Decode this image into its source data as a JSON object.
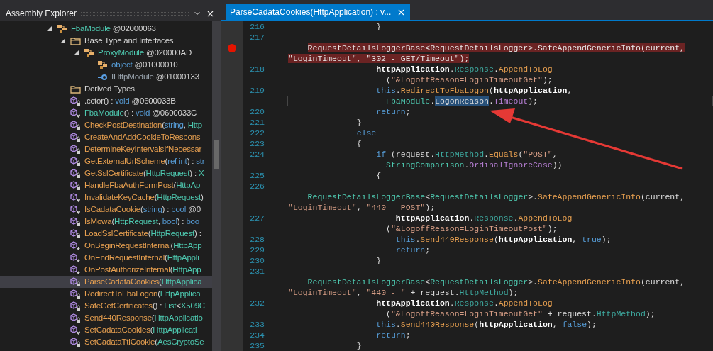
{
  "explorer": {
    "title": "Assembly Explorer",
    "tree": [
      {
        "kind": "class",
        "expanded": true,
        "selected": false,
        "parts": [
          {
            "text": "FbaModule",
            "kind": "type"
          },
          {
            "text": " @02000063",
            "kind": "plain"
          }
        ],
        "children": [
          {
            "kind": "folder",
            "expanded": true,
            "selected": false,
            "parts": [
              {
                "text": "Base Type and Interfaces",
                "kind": "plain"
              }
            ],
            "children": [
              {
                "kind": "class",
                "expanded": true,
                "selected": false,
                "parts": [
                  {
                    "text": "ProxyModule",
                    "kind": "type"
                  },
                  {
                    "text": " @020000AD",
                    "kind": "plain"
                  }
                ],
                "children": [
                  {
                    "kind": "class",
                    "selected": false,
                    "parts": [
                      {
                        "text": "object",
                        "kind": "keyword"
                      },
                      {
                        "text": " @01000010",
                        "kind": "plain"
                      }
                    ]
                  },
                  {
                    "kind": "interface",
                    "selected": false,
                    "parts": [
                      {
                        "text": "IHttpModule",
                        "kind": "interface"
                      },
                      {
                        "text": " @01000133",
                        "kind": "plain"
                      }
                    ]
                  }
                ]
              }
            ]
          },
          {
            "kind": "folder",
            "selected": false,
            "parts": [
              {
                "text": "Derived Types",
                "kind": "plain"
              }
            ]
          },
          {
            "kind": "method-private",
            "selected": false,
            "parts": [
              {
                "text": ".cctor() : ",
                "kind": "plain"
              },
              {
                "text": "void",
                "kind": "keyword"
              },
              {
                "text": " @0600033B",
                "kind": "plain"
              }
            ]
          },
          {
            "kind": "method-internal",
            "selected": false,
            "parts": [
              {
                "text": "FbaModule",
                "kind": "type"
              },
              {
                "text": "() : ",
                "kind": "plain"
              },
              {
                "text": "void",
                "kind": "keyword"
              },
              {
                "text": " @0600033C",
                "kind": "plain"
              }
            ]
          },
          {
            "kind": "method-private",
            "selected": false,
            "parts": [
              {
                "text": "CheckPostDestination",
                "kind": "method"
              },
              {
                "text": "(",
                "kind": "plain"
              },
              {
                "text": "string",
                "kind": "keyword"
              },
              {
                "text": ", ",
                "kind": "plain"
              },
              {
                "text": "Http",
                "kind": "type"
              }
            ]
          },
          {
            "kind": "method-private",
            "selected": false,
            "parts": [
              {
                "text": "CreateAndAddCookieToRespons",
                "kind": "method"
              }
            ]
          },
          {
            "kind": "method-private",
            "selected": false,
            "parts": [
              {
                "text": "DetermineKeyIntervalsIfNecessar",
                "kind": "method"
              }
            ]
          },
          {
            "kind": "method-private",
            "selected": false,
            "parts": [
              {
                "text": "GetExternalUrlScheme",
                "kind": "method"
              },
              {
                "text": "(",
                "kind": "plain"
              },
              {
                "text": "ref int",
                "kind": "keyword"
              },
              {
                "text": ") : ",
                "kind": "plain"
              },
              {
                "text": "str",
                "kind": "keyword"
              }
            ]
          },
          {
            "kind": "method-private",
            "selected": false,
            "parts": [
              {
                "text": "GetSslCertificate",
                "kind": "method"
              },
              {
                "text": "(",
                "kind": "plain"
              },
              {
                "text": "HttpRequest",
                "kind": "type"
              },
              {
                "text": ") : ",
                "kind": "plain"
              },
              {
                "text": "X",
                "kind": "type"
              }
            ]
          },
          {
            "kind": "method-private",
            "selected": false,
            "parts": [
              {
                "text": "HandleFbaAuthFormPost",
                "kind": "method"
              },
              {
                "text": "(",
                "kind": "plain"
              },
              {
                "text": "HttpAp",
                "kind": "type"
              }
            ]
          },
          {
            "kind": "method-internal",
            "selected": false,
            "parts": [
              {
                "text": "InvalidateKeyCache",
                "kind": "method"
              },
              {
                "text": "(",
                "kind": "plain"
              },
              {
                "text": "HttpRequest",
                "kind": "type"
              },
              {
                "text": ")",
                "kind": "plain"
              }
            ]
          },
          {
            "kind": "method-internal",
            "selected": false,
            "parts": [
              {
                "text": "IsCadataCookie",
                "kind": "method"
              },
              {
                "text": "(",
                "kind": "plain"
              },
              {
                "text": "string",
                "kind": "keyword"
              },
              {
                "text": ") : ",
                "kind": "plain"
              },
              {
                "text": "bool",
                "kind": "keyword"
              },
              {
                "text": " @0",
                "kind": "plain"
              }
            ]
          },
          {
            "kind": "method-private",
            "selected": false,
            "parts": [
              {
                "text": "IsMowa",
                "kind": "method"
              },
              {
                "text": "(",
                "kind": "plain"
              },
              {
                "text": "HttpRequest",
                "kind": "type"
              },
              {
                "text": ", ",
                "kind": "plain"
              },
              {
                "text": "bool",
                "kind": "keyword"
              },
              {
                "text": ") : ",
                "kind": "plain"
              },
              {
                "text": "boo",
                "kind": "keyword"
              }
            ]
          },
          {
            "kind": "method-private",
            "selected": false,
            "parts": [
              {
                "text": "LoadSslCertificate",
                "kind": "method"
              },
              {
                "text": "(",
                "kind": "plain"
              },
              {
                "text": "HttpRequest",
                "kind": "type"
              },
              {
                "text": ") :",
                "kind": "plain"
              }
            ]
          },
          {
            "kind": "method-static",
            "selected": false,
            "parts": [
              {
                "text": "OnBeginRequestInternal",
                "kind": "method"
              },
              {
                "text": "(",
                "kind": "plain"
              },
              {
                "text": "HttpApp",
                "kind": "type"
              }
            ]
          },
          {
            "kind": "method-static",
            "selected": false,
            "parts": [
              {
                "text": "OnEndRequestInternal",
                "kind": "method"
              },
              {
                "text": "(",
                "kind": "plain"
              },
              {
                "text": "HttpAppli",
                "kind": "type"
              }
            ]
          },
          {
            "kind": "method-static",
            "selected": false,
            "parts": [
              {
                "text": "OnPostAuthorizeInternal",
                "kind": "method"
              },
              {
                "text": "(",
                "kind": "plain"
              },
              {
                "text": "HttpApp",
                "kind": "type"
              }
            ]
          },
          {
            "kind": "method-private",
            "selected": true,
            "parts": [
              {
                "text": "ParseCadataCookies",
                "kind": "method"
              },
              {
                "text": "(",
                "kind": "plain"
              },
              {
                "text": "HttpApplica",
                "kind": "type"
              }
            ]
          },
          {
            "kind": "method-private",
            "selected": false,
            "parts": [
              {
                "text": "RedirectToFbaLogon",
                "kind": "method"
              },
              {
                "text": "(",
                "kind": "plain"
              },
              {
                "text": "HttpApplica",
                "kind": "type"
              }
            ]
          },
          {
            "kind": "method-private",
            "selected": false,
            "parts": [
              {
                "text": "SafeGetCertificates",
                "kind": "method"
              },
              {
                "text": "() : ",
                "kind": "plain"
              },
              {
                "text": "List",
                "kind": "type"
              },
              {
                "text": "<",
                "kind": "plain"
              },
              {
                "text": "X509C",
                "kind": "type"
              }
            ]
          },
          {
            "kind": "method-private",
            "selected": false,
            "parts": [
              {
                "text": "Send440Response",
                "kind": "method"
              },
              {
                "text": "(",
                "kind": "plain"
              },
              {
                "text": "HttpApplicatio",
                "kind": "type"
              }
            ]
          },
          {
            "kind": "method-internal",
            "selected": false,
            "parts": [
              {
                "text": "SetCadataCookies",
                "kind": "method"
              },
              {
                "text": "(",
                "kind": "plain"
              },
              {
                "text": "HttpApplicati",
                "kind": "type"
              }
            ]
          },
          {
            "kind": "method-private",
            "selected": false,
            "parts": [
              {
                "text": "SetCadataTtlCookie",
                "kind": "method"
              },
              {
                "text": "(",
                "kind": "plain"
              },
              {
                "text": "AesCryptoSe",
                "kind": "type"
              }
            ]
          }
        ]
      }
    ]
  },
  "editor": {
    "tabs": [
      {
        "label": "ParseCadataCookies(HttpApplication) : v...",
        "selected": true
      }
    ],
    "rows": [
      {
        "number": "216",
        "breakpoint": false,
        "error": false,
        "current": false,
        "tokens": [
          {
            "text": "                  }",
            "kind": "plain"
          }
        ]
      },
      {
        "number": "217",
        "breakpoint": false
      },
      {
        "breakpoint": true,
        "error": true,
        "current": false,
        "tokens": [
          {
            "text": "    RequestDetailsLoggerBase<RequestDetailsLogger>.SafeAppendGenericInfo(current,",
            "kind": "plain"
          }
        ]
      },
      {
        "breakpoint": false,
        "error": true,
        "current": false,
        "tokens": [
          {
            "text": "\"LoginTimeout\", \"302 - GET/Timeout\");",
            "kind": "plain"
          }
        ]
      },
      {
        "number": "218",
        "breakpoint": false,
        "error": false,
        "current": false,
        "tokens": [
          {
            "text": "                  httpApplication",
            "kind": "bold"
          },
          {
            "text": ".",
            "kind": "plain"
          },
          {
            "text": "Response",
            "kind": "member"
          },
          {
            "text": ".",
            "kind": "plain"
          },
          {
            "text": "AppendToLog",
            "kind": "method"
          }
        ]
      },
      {
        "breakpoint": false,
        "error": false,
        "current": false,
        "tokens": [
          {
            "text": "                    (",
            "kind": "plain"
          },
          {
            "text": "\"&LogoffReason=LoginTimeoutGet\"",
            "kind": "string"
          },
          {
            "text": ");",
            "kind": "plain"
          }
        ]
      },
      {
        "number": "219",
        "breakpoint": false,
        "error": false,
        "current": false,
        "tokens": [
          {
            "text": "                  this",
            "kind": "keyword"
          },
          {
            "text": ".",
            "kind": "plain"
          },
          {
            "text": "RedirectToFbaLogon",
            "kind": "method"
          },
          {
            "text": "(",
            "kind": "plain"
          },
          {
            "text": "httpApplication",
            "kind": "bold"
          },
          {
            "text": ",",
            "kind": "plain"
          }
        ]
      },
      {
        "breakpoint": false,
        "error": false,
        "current": true,
        "tokens": [
          {
            "text": "                    FbaModule",
            "kind": "type"
          },
          {
            "text": ".",
            "kind": "plain"
          },
          {
            "text": "LogonReason",
            "kind": "selection"
          },
          {
            "text": ".",
            "kind": "plain"
          },
          {
            "text": "Timeout",
            "kind": "enum"
          },
          {
            "text": ");",
            "kind": "plain"
          }
        ]
      },
      {
        "number": "220",
        "breakpoint": false,
        "error": false,
        "current": false,
        "tokens": [
          {
            "text": "                  return",
            "kind": "keyword"
          },
          {
            "text": ";",
            "kind": "plain"
          }
        ]
      },
      {
        "number": "221",
        "breakpoint": false,
        "error": false,
        "current": false,
        "tokens": [
          {
            "text": "              }",
            "kind": "plain"
          }
        ]
      },
      {
        "number": "222",
        "breakpoint": false,
        "error": false,
        "current": false,
        "tokens": [
          {
            "text": "              else",
            "kind": "keyword"
          }
        ]
      },
      {
        "number": "223",
        "breakpoint": false,
        "error": false,
        "current": false,
        "tokens": [
          {
            "text": "              {",
            "kind": "plain"
          }
        ]
      },
      {
        "number": "224",
        "breakpoint": false,
        "error": false,
        "current": false,
        "tokens": [
          {
            "text": "                  if",
            "kind": "keyword"
          },
          {
            "text": " (request.",
            "kind": "plain"
          },
          {
            "text": "HttpMethod",
            "kind": "member"
          },
          {
            "text": ".",
            "kind": "plain"
          },
          {
            "text": "Equals",
            "kind": "method"
          },
          {
            "text": "(",
            "kind": "plain"
          },
          {
            "text": "\"POST\"",
            "kind": "string"
          },
          {
            "text": ",",
            "kind": "plain"
          }
        ]
      },
      {
        "breakpoint": false,
        "error": false,
        "current": false,
        "tokens": [
          {
            "text": "                    StringComparison",
            "kind": "type"
          },
          {
            "text": ".",
            "kind": "plain"
          },
          {
            "text": "OrdinalIgnoreCase",
            "kind": "enum"
          },
          {
            "text": "))",
            "kind": "plain"
          }
        ]
      },
      {
        "number": "225",
        "breakpoint": false,
        "error": false,
        "current": false,
        "tokens": [
          {
            "text": "                  {",
            "kind": "plain"
          }
        ]
      },
      {
        "number": "226",
        "breakpoint": false
      },
      {
        "breakpoint": false,
        "error": false,
        "current": false,
        "tokens": [
          {
            "text": "    RequestDetailsLoggerBase",
            "kind": "type"
          },
          {
            "text": "<",
            "kind": "plain"
          },
          {
            "text": "RequestDetailsLogger",
            "kind": "type"
          },
          {
            "text": ">.",
            "kind": "plain"
          },
          {
            "text": "SafeAppendGenericInfo",
            "kind": "method"
          },
          {
            "text": "(current,",
            "kind": "plain"
          }
        ]
      },
      {
        "breakpoint": false,
        "error": false,
        "current": false,
        "tokens": [
          {
            "text": "\"LoginTimeout\"",
            "kind": "string"
          },
          {
            "text": ", ",
            "kind": "plain"
          },
          {
            "text": "\"440 - POST\"",
            "kind": "string"
          },
          {
            "text": ");",
            "kind": "plain"
          }
        ]
      },
      {
        "number": "227",
        "breakpoint": false,
        "error": false,
        "current": false,
        "tokens": [
          {
            "text": "                      httpApplication",
            "kind": "bold"
          },
          {
            "text": ".",
            "kind": "plain"
          },
          {
            "text": "Response",
            "kind": "member"
          },
          {
            "text": ".",
            "kind": "plain"
          },
          {
            "text": "AppendToLog",
            "kind": "method"
          }
        ]
      },
      {
        "breakpoint": false,
        "error": false,
        "current": false,
        "tokens": [
          {
            "text": "                    (",
            "kind": "plain"
          },
          {
            "text": "\"&LogoffReason=LoginTimeoutPost\"",
            "kind": "string"
          },
          {
            "text": ");",
            "kind": "plain"
          }
        ]
      },
      {
        "number": "228",
        "breakpoint": false,
        "error": false,
        "current": false,
        "tokens": [
          {
            "text": "                      this",
            "kind": "keyword"
          },
          {
            "text": ".",
            "kind": "plain"
          },
          {
            "text": "Send440Response",
            "kind": "method"
          },
          {
            "text": "(",
            "kind": "plain"
          },
          {
            "text": "httpApplication",
            "kind": "bold"
          },
          {
            "text": ", ",
            "kind": "plain"
          },
          {
            "text": "true",
            "kind": "keyword"
          },
          {
            "text": ");",
            "kind": "plain"
          }
        ]
      },
      {
        "number": "229",
        "breakpoint": false,
        "error": false,
        "current": false,
        "tokens": [
          {
            "text": "                      return",
            "kind": "keyword"
          },
          {
            "text": ";",
            "kind": "plain"
          }
        ]
      },
      {
        "number": "230",
        "breakpoint": false,
        "error": false,
        "current": false,
        "tokens": [
          {
            "text": "                  }",
            "kind": "plain"
          }
        ]
      },
      {
        "number": "231",
        "breakpoint": false
      },
      {
        "breakpoint": false,
        "error": false,
        "current": false,
        "tokens": [
          {
            "text": "    RequestDetailsLoggerBase",
            "kind": "type"
          },
          {
            "text": "<",
            "kind": "plain"
          },
          {
            "text": "RequestDetailsLogger",
            "kind": "type"
          },
          {
            "text": ">.",
            "kind": "plain"
          },
          {
            "text": "SafeAppendGenericInfo",
            "kind": "method"
          },
          {
            "text": "(current,",
            "kind": "plain"
          }
        ]
      },
      {
        "breakpoint": false,
        "error": false,
        "current": false,
        "tokens": [
          {
            "text": "\"LoginTimeout\"",
            "kind": "string"
          },
          {
            "text": ", ",
            "kind": "plain"
          },
          {
            "text": "\"440 - \"",
            "kind": "string"
          },
          {
            "text": " + request.",
            "kind": "plain"
          },
          {
            "text": "HttpMethod",
            "kind": "member"
          },
          {
            "text": ");",
            "kind": "plain"
          }
        ]
      },
      {
        "number": "232",
        "breakpoint": false,
        "error": false,
        "current": false,
        "tokens": [
          {
            "text": "                  httpApplication",
            "kind": "bold"
          },
          {
            "text": ".",
            "kind": "plain"
          },
          {
            "text": "Response",
            "kind": "member"
          },
          {
            "text": ".",
            "kind": "plain"
          },
          {
            "text": "AppendToLog",
            "kind": "method"
          }
        ]
      },
      {
        "breakpoint": false,
        "error": false,
        "current": false,
        "tokens": [
          {
            "text": "                    (",
            "kind": "plain"
          },
          {
            "text": "\"&LogoffReason=LoginTimeoutGet\"",
            "kind": "string"
          },
          {
            "text": " + request.",
            "kind": "plain"
          },
          {
            "text": "HttpMethod",
            "kind": "member"
          },
          {
            "text": ");",
            "kind": "plain"
          }
        ]
      },
      {
        "number": "233",
        "breakpoint": false,
        "error": false,
        "current": false,
        "tokens": [
          {
            "text": "                  this",
            "kind": "keyword"
          },
          {
            "text": ".",
            "kind": "plain"
          },
          {
            "text": "Send440Response",
            "kind": "method"
          },
          {
            "text": "(",
            "kind": "plain"
          },
          {
            "text": "httpApplication",
            "kind": "bold"
          },
          {
            "text": ", ",
            "kind": "plain"
          },
          {
            "text": "false",
            "kind": "keyword"
          },
          {
            "text": ");",
            "kind": "plain"
          }
        ]
      },
      {
        "number": "234",
        "breakpoint": false,
        "error": false,
        "current": false,
        "tokens": [
          {
            "text": "                  return",
            "kind": "keyword"
          },
          {
            "text": ";",
            "kind": "plain"
          }
        ]
      },
      {
        "number": "235",
        "breakpoint": false,
        "error": false,
        "current": false,
        "tokens": [
          {
            "text": "              }",
            "kind": "plain"
          }
        ]
      }
    ]
  }
}
